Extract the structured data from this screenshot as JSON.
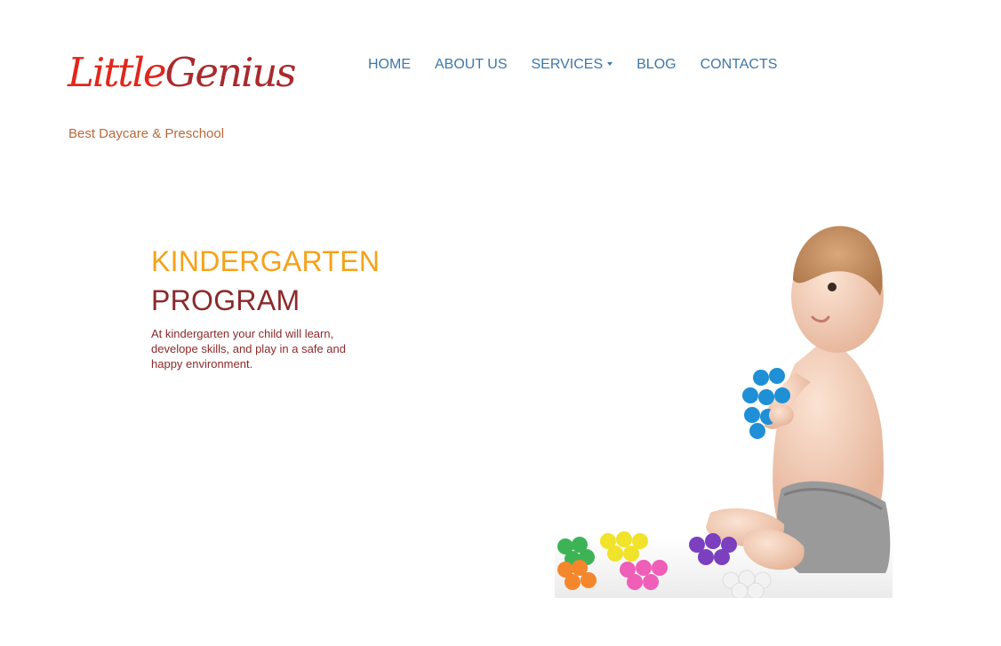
{
  "brand": {
    "logo_word1": "Little",
    "logo_word2": "Genius",
    "tagline": "Best Daycare & Preschool"
  },
  "nav": {
    "items": [
      "HOME",
      "ABOUT US",
      "SERVICES",
      "BLOG",
      "CONTACTS"
    ]
  },
  "hero": {
    "title_line1": "KINDERGARTEN",
    "title_line2": "PROGRAM",
    "description": "At kindergarten your child will learn, develope skills, and play in a safe and happy environment."
  },
  "colors": {
    "logo_red": "#e2261b",
    "logo_maroon": "#a92a2e",
    "nav_blue": "#3e77a8",
    "accent_orange": "#f5a21a",
    "maroon_text": "#8b2a2b",
    "tagline": "#b86a3c"
  }
}
